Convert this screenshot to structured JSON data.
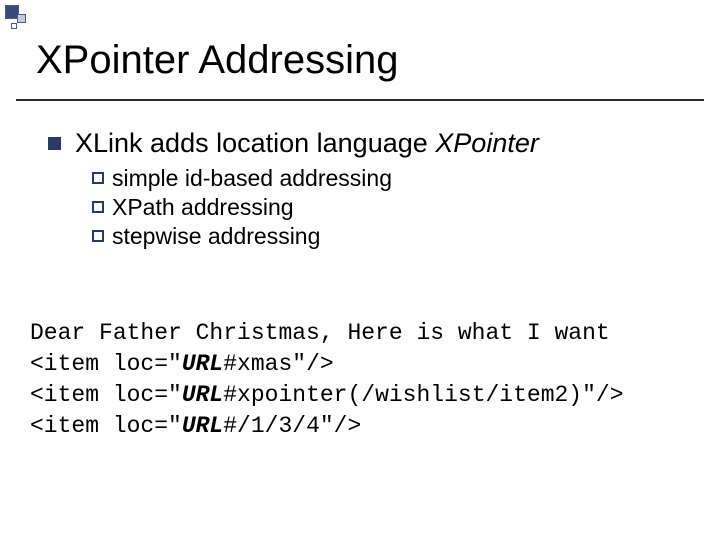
{
  "title": "XPointer Addressing",
  "main_bullet": {
    "prefix": "XLink adds location language ",
    "emph": "XPointer"
  },
  "sub_bullets": [
    "simple id-based addressing",
    "XPath addressing",
    "stepwise addressing"
  ],
  "code": {
    "line1": "Dear Father Christmas, Here is what I want",
    "line2_a": "<item loc=\"",
    "line2_b": "URL",
    "line2_c": "#xmas\"/>",
    "line3_a": "<item loc=\"",
    "line3_b": "URL",
    "line3_c": "#xpointer(/wishlist/item2)\"/>",
    "line4_a": "<item loc=\"",
    "line4_b": "URL",
    "line4_c": "#/1/3/4\"/>"
  }
}
